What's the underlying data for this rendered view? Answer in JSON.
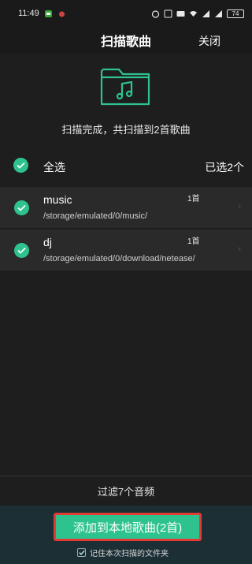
{
  "status_bar": {
    "time": "11:49",
    "battery": "74"
  },
  "header": {
    "title": "扫描歌曲",
    "close_label": "关闭"
  },
  "hero": {
    "icon": "music-folder-icon",
    "scan_result": "扫描完成，共扫描到2首歌曲"
  },
  "select_all": {
    "label": "全选",
    "selected_count": "已选2个",
    "checked": true
  },
  "folders": [
    {
      "name": "music",
      "path": "/storage/emulated/0/music/",
      "songs": "1首",
      "checked": true
    },
    {
      "name": "dj",
      "path": "/storage/emulated/0/download/netease/",
      "songs": "1首",
      "checked": true
    }
  ],
  "filter_label": "过滤7个音频",
  "add_button_label": "添加到本地歌曲(2首)",
  "remember": {
    "label": "记住本次扫描的文件夹",
    "checked": true
  },
  "colors": {
    "accent": "#2ec38e",
    "background": "#1e1e1e",
    "row_background": "#2a2a2a",
    "bottom_background": "#1c2f35",
    "highlight_border": "#e53935"
  }
}
